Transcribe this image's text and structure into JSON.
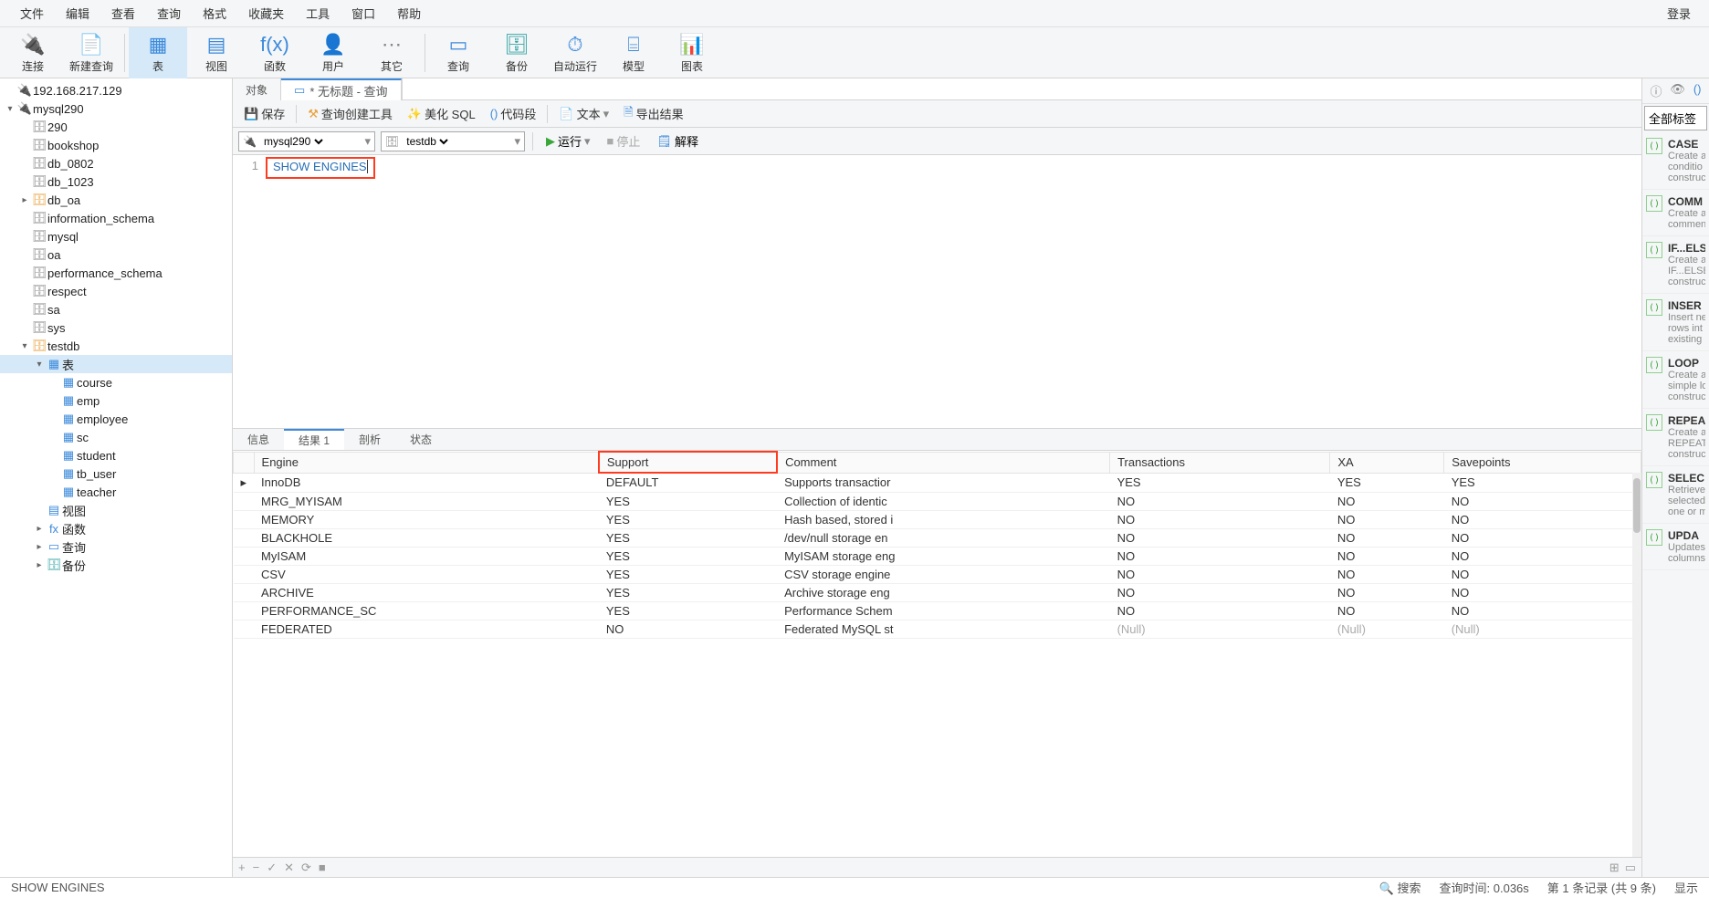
{
  "menubar": [
    "文件",
    "编辑",
    "查看",
    "查询",
    "格式",
    "收藏夹",
    "工具",
    "窗口",
    "帮助"
  ],
  "menubar_right": "登录",
  "toolbar": [
    {
      "label": "连接",
      "icon": "🔌",
      "color": "ic-teal"
    },
    {
      "label": "新建查询",
      "icon": "📄",
      "color": "ic-blue"
    },
    {
      "label": "表",
      "icon": "▦",
      "color": "ic-blue",
      "active": true
    },
    {
      "label": "视图",
      "icon": "▤",
      "color": "ic-blue"
    },
    {
      "label": "函数",
      "icon": "f(x)",
      "color": "ic-blue"
    },
    {
      "label": "用户",
      "icon": "👤",
      "color": "ic-orange"
    },
    {
      "label": "其它",
      "icon": "⋯",
      "color": "ic-grey"
    },
    {
      "label": "查询",
      "icon": "▭",
      "color": "ic-blue"
    },
    {
      "label": "备份",
      "icon": "🗄",
      "color": "ic-teal"
    },
    {
      "label": "自动运行",
      "icon": "⏱",
      "color": "ic-blue"
    },
    {
      "label": "模型",
      "icon": "⌸",
      "color": "ic-blue"
    },
    {
      "label": "图表",
      "icon": "📊",
      "color": "ic-orange"
    }
  ],
  "sidebar": [
    {
      "label": "192.168.217.129",
      "icon": "🔌",
      "color": "ic-green",
      "indent": 0,
      "toggle": ""
    },
    {
      "label": "mysql290",
      "icon": "🔌",
      "color": "ic-green",
      "indent": 0,
      "toggle": "▾"
    },
    {
      "label": "290",
      "icon": "🗄",
      "color": "ic-grey",
      "indent": 1,
      "toggle": ""
    },
    {
      "label": "bookshop",
      "icon": "🗄",
      "color": "ic-grey",
      "indent": 1,
      "toggle": ""
    },
    {
      "label": "db_0802",
      "icon": "🗄",
      "color": "ic-grey",
      "indent": 1,
      "toggle": ""
    },
    {
      "label": "db_1023",
      "icon": "🗄",
      "color": "ic-grey",
      "indent": 1,
      "toggle": ""
    },
    {
      "label": "db_oa",
      "icon": "🗄",
      "color": "ic-orange",
      "indent": 1,
      "toggle": "▸"
    },
    {
      "label": "information_schema",
      "icon": "🗄",
      "color": "ic-grey",
      "indent": 1,
      "toggle": ""
    },
    {
      "label": "mysql",
      "icon": "🗄",
      "color": "ic-grey",
      "indent": 1,
      "toggle": ""
    },
    {
      "label": "oa",
      "icon": "🗄",
      "color": "ic-grey",
      "indent": 1,
      "toggle": ""
    },
    {
      "label": "performance_schema",
      "icon": "🗄",
      "color": "ic-grey",
      "indent": 1,
      "toggle": ""
    },
    {
      "label": "respect",
      "icon": "🗄",
      "color": "ic-grey",
      "indent": 1,
      "toggle": ""
    },
    {
      "label": "sa",
      "icon": "🗄",
      "color": "ic-grey",
      "indent": 1,
      "toggle": ""
    },
    {
      "label": "sys",
      "icon": "🗄",
      "color": "ic-grey",
      "indent": 1,
      "toggle": ""
    },
    {
      "label": "testdb",
      "icon": "🗄",
      "color": "ic-orange",
      "indent": 1,
      "toggle": "▾"
    },
    {
      "label": "表",
      "icon": "▦",
      "color": "ic-blue",
      "indent": 2,
      "toggle": "▾",
      "selected": true
    },
    {
      "label": "course",
      "icon": "▦",
      "color": "ic-blue",
      "indent": 3,
      "toggle": ""
    },
    {
      "label": "emp",
      "icon": "▦",
      "color": "ic-blue",
      "indent": 3,
      "toggle": ""
    },
    {
      "label": "employee",
      "icon": "▦",
      "color": "ic-blue",
      "indent": 3,
      "toggle": ""
    },
    {
      "label": "sc",
      "icon": "▦",
      "color": "ic-blue",
      "indent": 3,
      "toggle": ""
    },
    {
      "label": "student",
      "icon": "▦",
      "color": "ic-blue",
      "indent": 3,
      "toggle": ""
    },
    {
      "label": "tb_user",
      "icon": "▦",
      "color": "ic-blue",
      "indent": 3,
      "toggle": ""
    },
    {
      "label": "teacher",
      "icon": "▦",
      "color": "ic-blue",
      "indent": 3,
      "toggle": ""
    },
    {
      "label": "视图",
      "icon": "▤",
      "color": "ic-blue",
      "indent": 2,
      "toggle": ""
    },
    {
      "label": "函数",
      "icon": "fx",
      "color": "ic-blue",
      "indent": 2,
      "toggle": "▸"
    },
    {
      "label": "查询",
      "icon": "▭",
      "color": "ic-blue",
      "indent": 2,
      "toggle": "▸"
    },
    {
      "label": "备份",
      "icon": "🗄",
      "color": "ic-teal",
      "indent": 2,
      "toggle": "▸"
    }
  ],
  "doc_tabs": {
    "object": "对象",
    "query": "* 无标题 - 查询"
  },
  "sub_toolbar": {
    "save": "保存",
    "query_builder": "查询创建工具",
    "beautify": "美化 SQL",
    "snippet": "代码段",
    "text": "文本",
    "export": "导出结果"
  },
  "query_bar": {
    "connection": "mysql290",
    "database": "testdb",
    "run": "运行",
    "stop": "停止",
    "explain": "解释"
  },
  "editor": {
    "line1_num": "1",
    "line1_code": "SHOW ENGINES"
  },
  "result_tabs": [
    "信息",
    "结果 1",
    "剖析",
    "状态"
  ],
  "result_headers": [
    "Engine",
    "Support",
    "Comment",
    "Transactions",
    "XA",
    "Savepoints"
  ],
  "result_rows": [
    {
      "marker": "▸",
      "engine": "InnoDB",
      "support": "DEFAULT",
      "comment": "Supports transactior",
      "tx": "YES",
      "xa": "YES",
      "sp": "YES"
    },
    {
      "marker": "",
      "engine": "MRG_MYISAM",
      "support": "YES",
      "comment": "Collection of identic",
      "tx": "NO",
      "xa": "NO",
      "sp": "NO"
    },
    {
      "marker": "",
      "engine": "MEMORY",
      "support": "YES",
      "comment": "Hash based, stored i",
      "tx": "NO",
      "xa": "NO",
      "sp": "NO"
    },
    {
      "marker": "",
      "engine": "BLACKHOLE",
      "support": "YES",
      "comment": "/dev/null storage en",
      "tx": "NO",
      "xa": "NO",
      "sp": "NO"
    },
    {
      "marker": "",
      "engine": "MyISAM",
      "support": "YES",
      "comment": "MyISAM storage eng",
      "tx": "NO",
      "xa": "NO",
      "sp": "NO"
    },
    {
      "marker": "",
      "engine": "CSV",
      "support": "YES",
      "comment": "CSV storage engine",
      "tx": "NO",
      "xa": "NO",
      "sp": "NO"
    },
    {
      "marker": "",
      "engine": "ARCHIVE",
      "support": "YES",
      "comment": "Archive storage eng",
      "tx": "NO",
      "xa": "NO",
      "sp": "NO"
    },
    {
      "marker": "",
      "engine": "PERFORMANCE_SC",
      "support": "YES",
      "comment": "Performance Schem",
      "tx": "NO",
      "xa": "NO",
      "sp": "NO"
    },
    {
      "marker": "",
      "engine": "FEDERATED",
      "support": "NO",
      "comment": "Federated MySQL st",
      "tx": "(Null)",
      "xa": "(Null)",
      "sp": "(Null)"
    }
  ],
  "right": {
    "tags_label": "全部标签",
    "snippets": [
      {
        "title": "CASE",
        "desc1": "Create a",
        "desc2": "conditio",
        "desc3": "construc"
      },
      {
        "title": "COMM",
        "desc1": "Create a",
        "desc2": "commen",
        "desc3": ""
      },
      {
        "title": "IF...ELS",
        "desc1": "Create a",
        "desc2": "IF...ELSE",
        "desc3": "construc"
      },
      {
        "title": "INSER",
        "desc1": "Insert ne",
        "desc2": "rows int",
        "desc3": "existing"
      },
      {
        "title": "LOOP",
        "desc1": "Create a",
        "desc2": "simple lo",
        "desc3": "construc"
      },
      {
        "title": "REPEA",
        "desc1": "Create a",
        "desc2": "REPEAT",
        "desc3": "construc"
      },
      {
        "title": "SELEC",
        "desc1": "Retrieve",
        "desc2": "selected",
        "desc3": "one or m"
      },
      {
        "title": "UPDA",
        "desc1": "Updates",
        "desc2": "columns",
        "desc3": ""
      }
    ]
  },
  "table_footer_right": {
    "grid": "⊞",
    "form": "▭"
  },
  "status": {
    "query": "SHOW ENGINES",
    "search_hint": "搜索",
    "elapsed": "查询时间: 0.036s",
    "records": "第 1 条记录 (共 9 条)",
    "show": "显示"
  }
}
